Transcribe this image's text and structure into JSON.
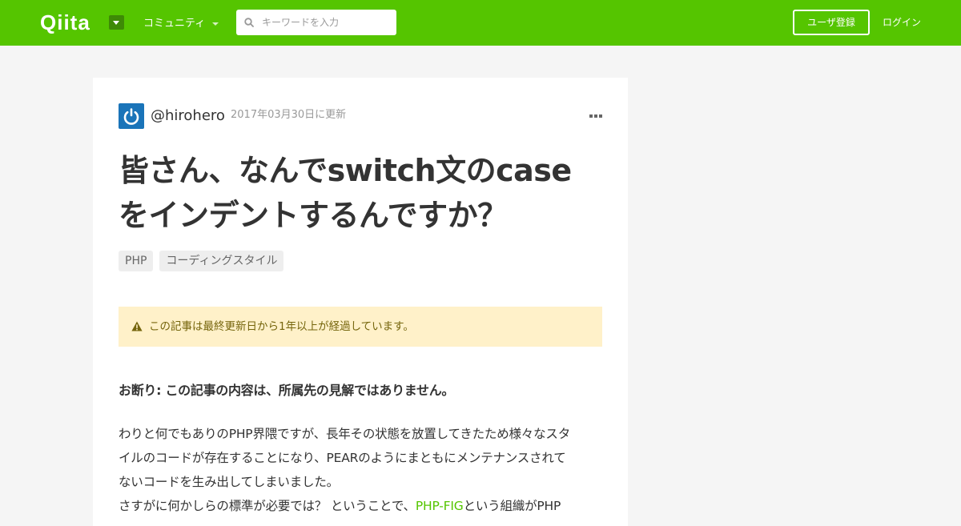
{
  "header": {
    "logo": "Qiita",
    "community_label": "コミュニティ",
    "search_placeholder": "キーワードを入力",
    "signup_label": "ユーザ登録",
    "login_label": "ログイン",
    "brand_color": "#55c500"
  },
  "article": {
    "author": "@hirohero",
    "updated": "2017年03月30日に更新",
    "title_line1": "皆さん、なんでswitch文のcase",
    "title_line2": "をインデントするんですか？",
    "tags": [
      "PHP",
      "コーディングスタイル"
    ],
    "notice": "この記事は最終更新日から1年以上が経過しています。",
    "disclaimer": "お断り: この記事の内容は、所属先の見解ではありません。",
    "para1_line1": "わりと何でもありのPHP界隈ですが、長年その状態を放置してきたため様々なスタ",
    "para1_line2": "イルのコードが存在することになり、PEARのようにまともにメンテナンスされて",
    "para1_line3": "ないコードを生み出してしまいました。",
    "para2_before": "さすがに何かしらの標準が必要では？ ということで、",
    "para2_link": "PHP-FIG",
    "para2_after": "という組織がPHP"
  }
}
